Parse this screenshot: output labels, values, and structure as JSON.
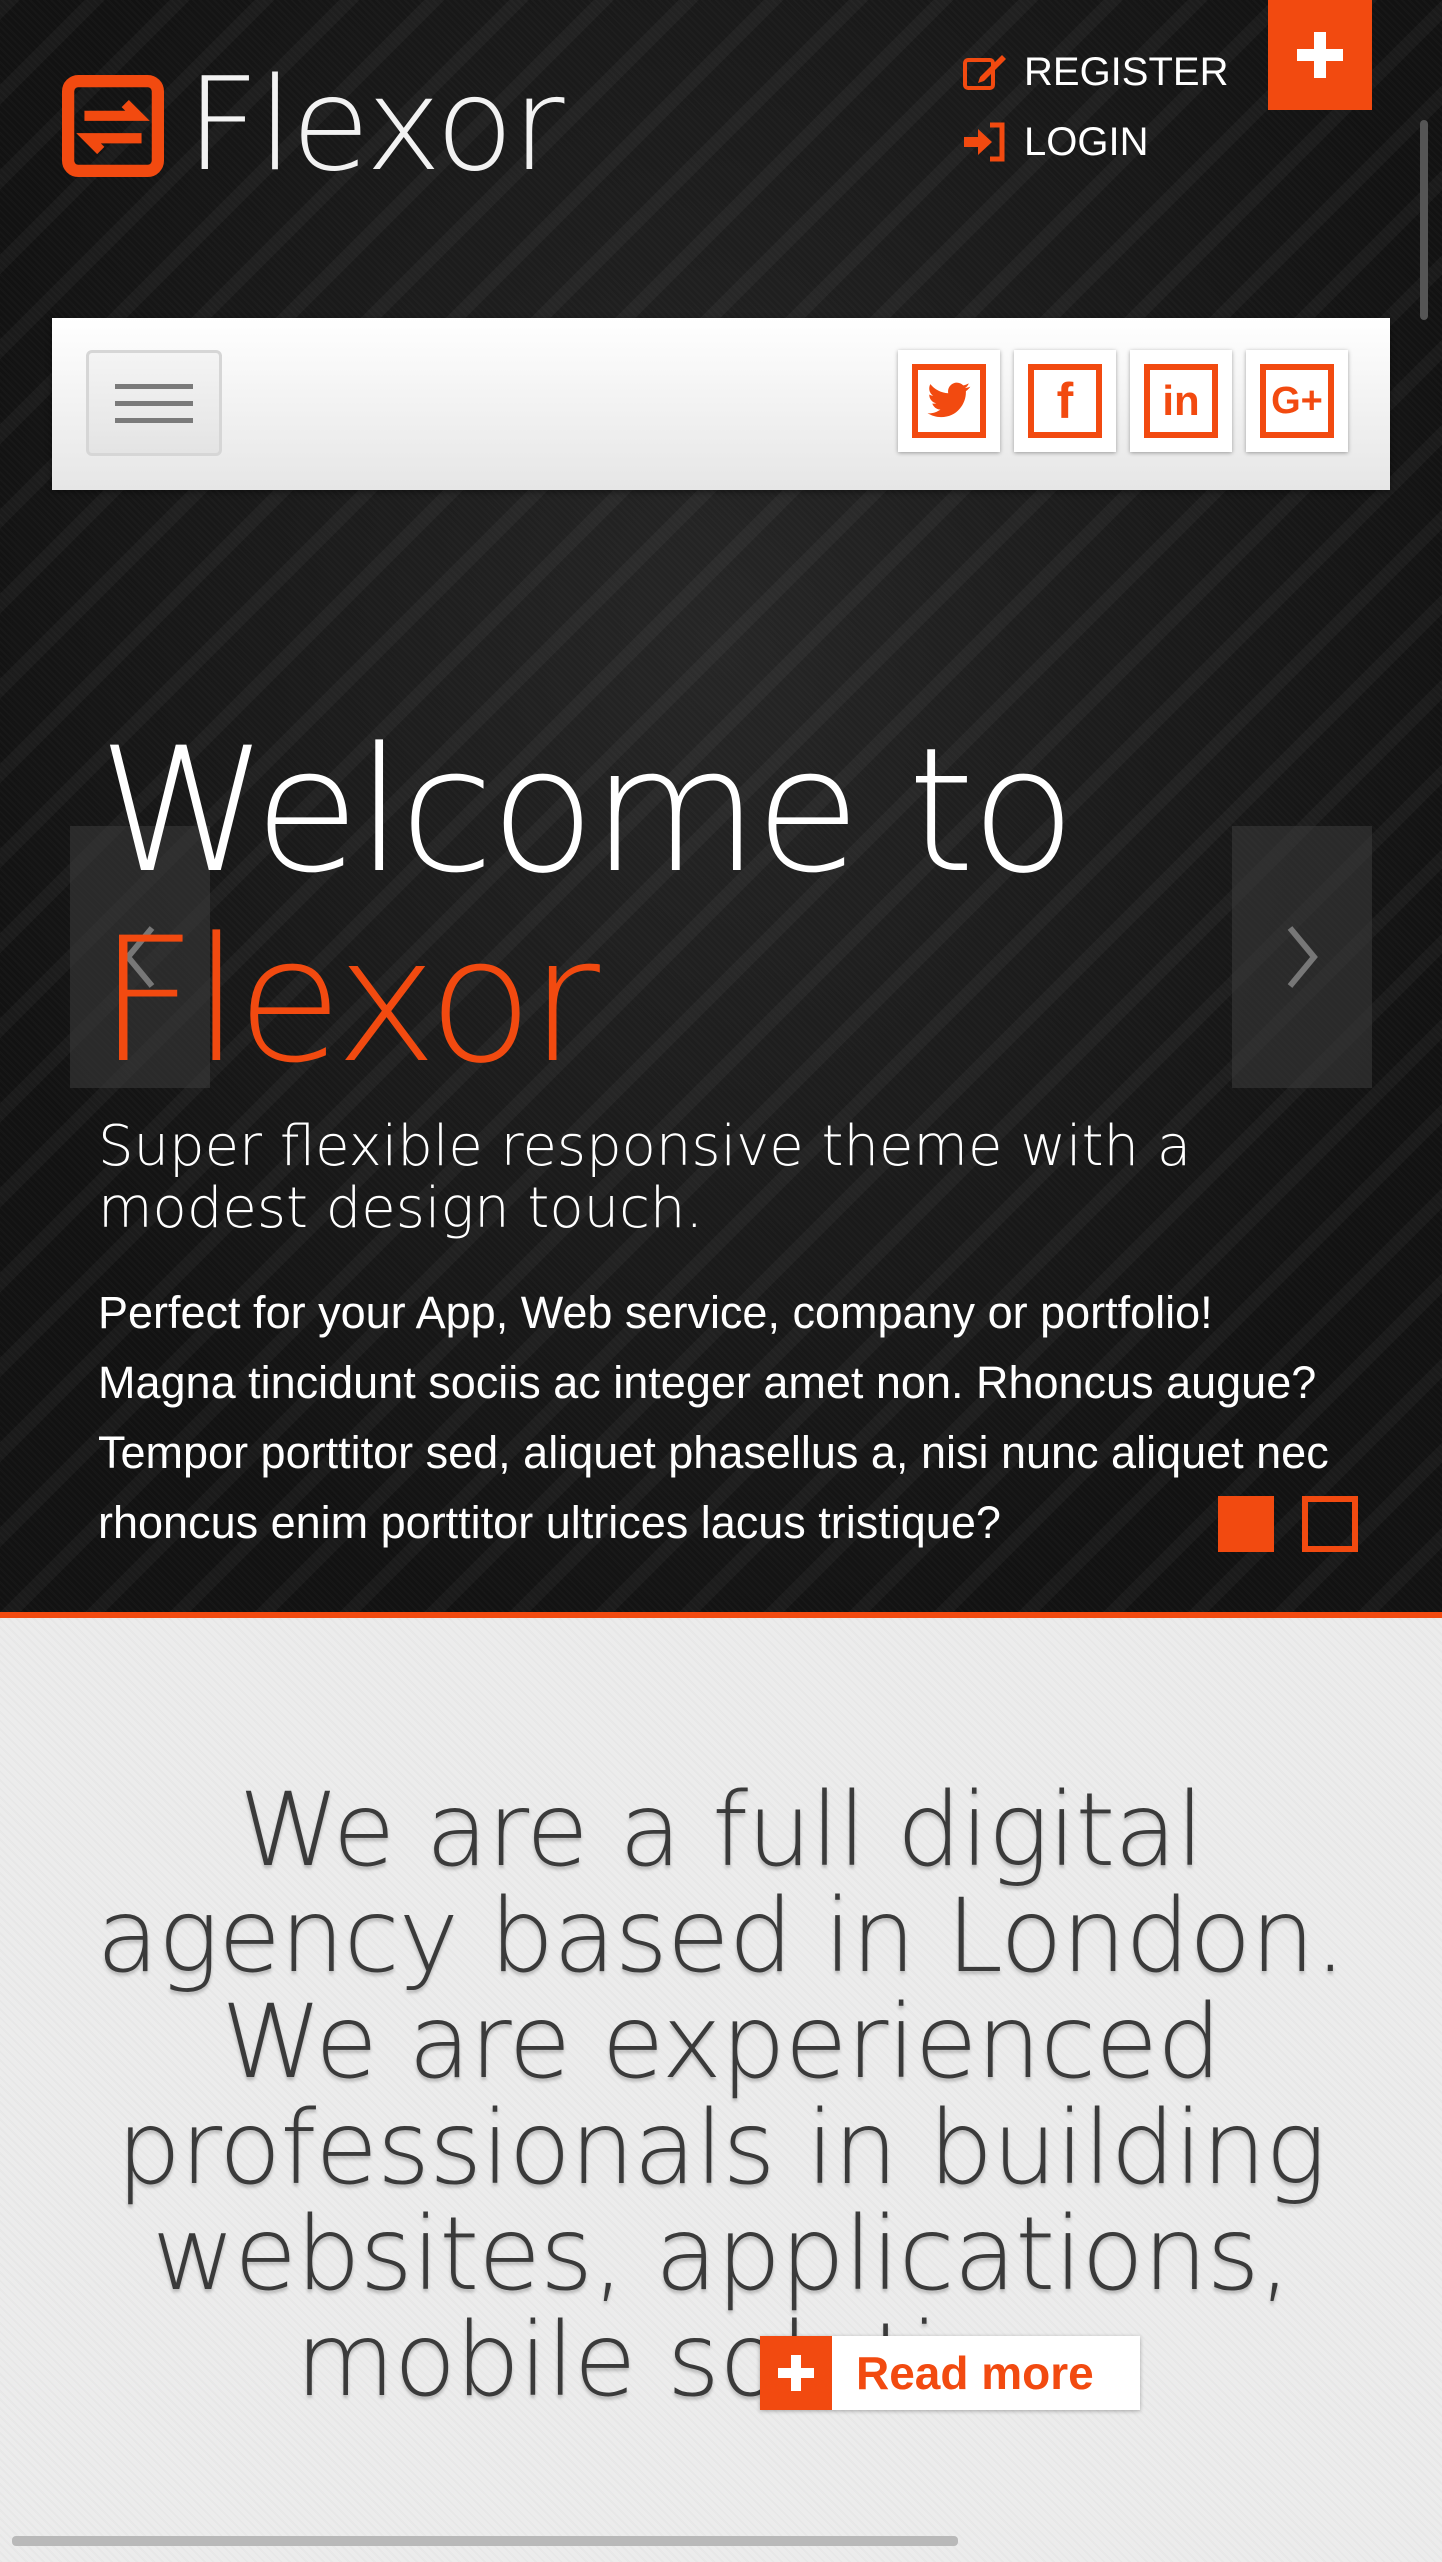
{
  "brand": {
    "name": "Flexor",
    "accent_color": "#f24a10",
    "logo_icon": "swap-arrows-icon"
  },
  "header": {
    "register_label": "REGISTER",
    "login_label": "LOGIN",
    "register_icon": "edit-icon",
    "login_icon": "sign-in-icon",
    "corner_button_icon": "plus-icon"
  },
  "navbar": {
    "menu_icon": "hamburger-icon",
    "socials": [
      {
        "name": "twitter",
        "icon": "twitter-icon"
      },
      {
        "name": "facebook",
        "glyph": "f",
        "icon": "facebook-icon"
      },
      {
        "name": "linkedin",
        "glyph": "in",
        "icon": "linkedin-icon"
      },
      {
        "name": "google-plus",
        "glyph": "G+",
        "icon": "google-plus-icon"
      }
    ]
  },
  "hero": {
    "title_line1": "Welcome to",
    "title_line2": "Flexor",
    "subtitle": "Super flexible responsive theme with a modest design touch.",
    "description": "Perfect for your App, Web service, company or portfolio! Magna tincidunt sociis ac integer amet non. Rhoncus augue? Tempor porttitor sed, aliquet phasellus a, nisi nunc aliquet nec rhoncus enim porttitor ultrices lacus tristique?",
    "prev_icon": "chevron-left-icon",
    "next_icon": "chevron-right-icon",
    "slides_total": 2,
    "active_slide": 1
  },
  "agency": {
    "text": "We are a full digital agency based in London. We are experienced professionals in building websites, applications, mobile solutions.",
    "readmore_label": "Read more",
    "readmore_icon": "plus-icon"
  }
}
